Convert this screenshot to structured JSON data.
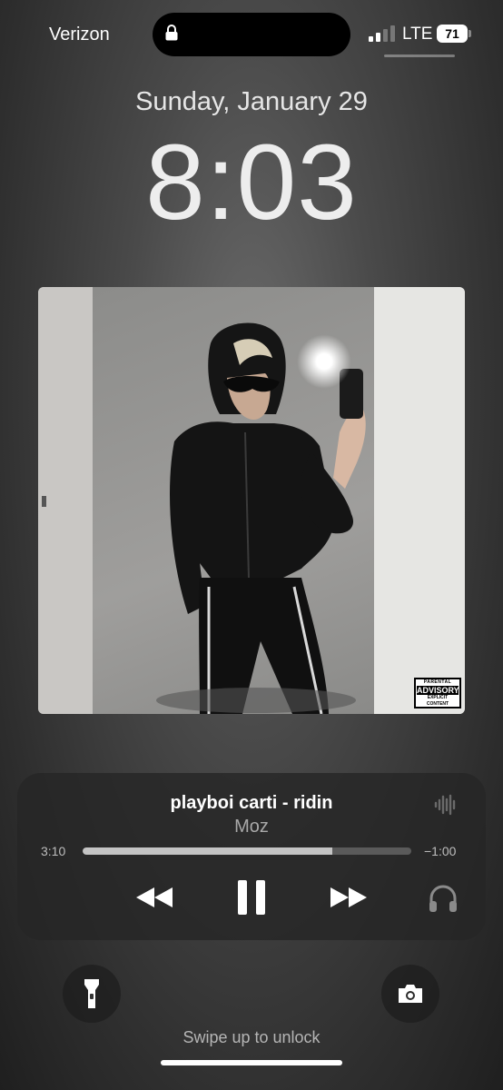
{
  "status_bar": {
    "carrier": "Verizon",
    "network": "LTE",
    "battery": "71",
    "lock_icon": "lock-icon",
    "signal_icon": "cellular-signal-icon"
  },
  "lock_screen": {
    "date": "Sunday, January 29",
    "time": "8:03"
  },
  "artwork": {
    "advisory_line1": "PARENTAL",
    "advisory_line2": "ADVISORY",
    "advisory_line3": "EXPLICIT CONTENT"
  },
  "now_playing": {
    "title": "playboi carti - ridin",
    "artist": "Moz",
    "elapsed": "3:10",
    "remaining": "−1:00",
    "progress": 0.76,
    "controls": [
      "rewind-icon",
      "pause-icon",
      "fast-forward-icon",
      "airpods-icon"
    ]
  },
  "quick_actions": {
    "left": "flashlight-icon",
    "right": "camera-icon"
  },
  "footer": {
    "hint": "Swipe up to unlock"
  },
  "colors": {
    "text_primary": "#ffffff",
    "text_secondary": "#a8a8a8",
    "progress_fill": "#c4c4c4"
  }
}
